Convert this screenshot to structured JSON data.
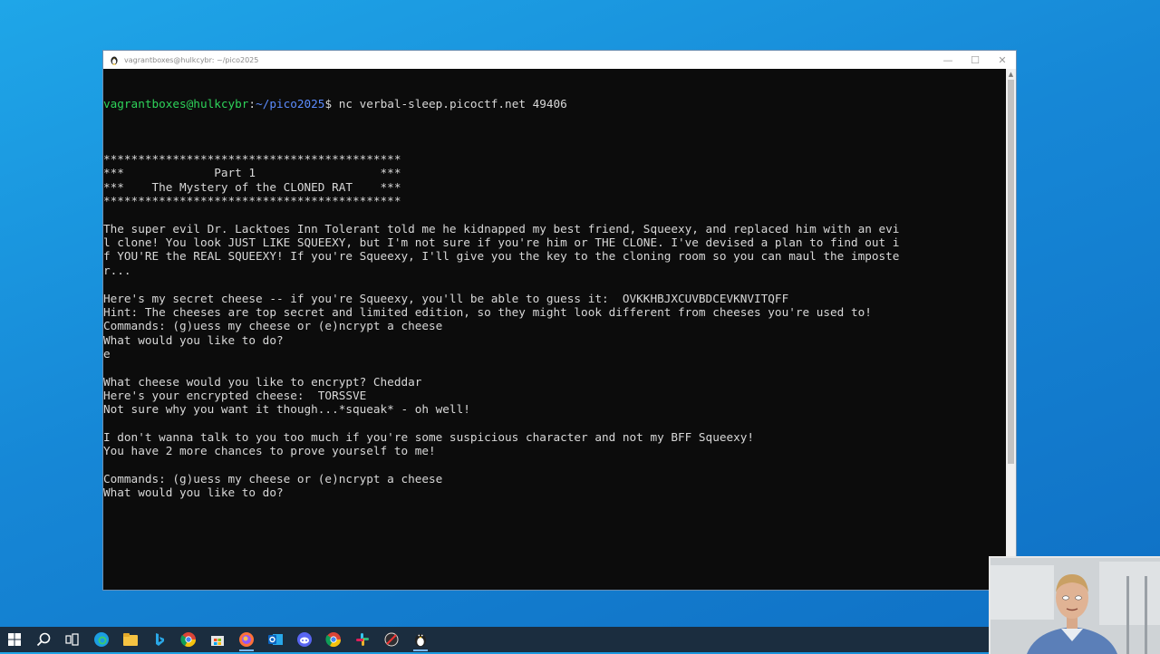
{
  "window": {
    "title": "vagrantboxes@hulkcybr: ~/pico2025",
    "controls": {
      "minimize": "—",
      "maximize": "☐",
      "close": "✕"
    }
  },
  "terminal": {
    "prompt_user": "vagrantboxes@hulkcybr",
    "prompt_sep": ":",
    "prompt_path": "~/pico2025",
    "prompt_end": "$ ",
    "command": "nc verbal-sleep.picoctf.net 49406",
    "lines": [
      "",
      "*******************************************",
      "***             Part 1                  ***",
      "***    The Mystery of the CLONED RAT    ***",
      "*******************************************",
      "",
      "The super evil Dr. Lacktoes Inn Tolerant told me he kidnapped my best friend, Squeexy, and replaced him with an evi",
      "l clone! You look JUST LIKE SQUEEXY, but I'm not sure if you're him or THE CLONE. I've devised a plan to find out i",
      "f YOU'RE the REAL SQUEEXY! If you're Squeexy, I'll give you the key to the cloning room so you can maul the imposte",
      "r...",
      "",
      "Here's my secret cheese -- if you're Squeexy, you'll be able to guess it:  OVKKHBJXCUVBDCEVKNVITQFF",
      "Hint: The cheeses are top secret and limited edition, so they might look different from cheeses you're used to!",
      "Commands: (g)uess my cheese or (e)ncrypt a cheese",
      "What would you like to do?",
      "e",
      "",
      "What cheese would you like to encrypt? Cheddar",
      "Here's your encrypted cheese:  TORSSVE",
      "Not sure why you want it though...*squeak* - oh well!",
      "",
      "I don't wanna talk to you too much if you're some suspicious character and not my BFF Squeexy!",
      "You have 2 more chances to prove yourself to me!",
      "",
      "Commands: (g)uess my cheese or (e)ncrypt a cheese",
      "What would you like to do?"
    ]
  },
  "taskbar": {
    "items": [
      {
        "name": "start-icon"
      },
      {
        "name": "search-icon"
      },
      {
        "name": "task-view-icon"
      },
      {
        "name": "edge-icon"
      },
      {
        "name": "file-explorer-icon"
      },
      {
        "name": "bing-icon"
      },
      {
        "name": "chrome-icon"
      },
      {
        "name": "store-icon"
      },
      {
        "name": "firefox-icon"
      },
      {
        "name": "outlook-icon"
      },
      {
        "name": "discord-icon"
      },
      {
        "name": "chrome-alt-icon"
      },
      {
        "name": "slack-icon"
      },
      {
        "name": "obs-icon"
      },
      {
        "name": "linux-terminal-icon"
      }
    ]
  },
  "colors": {
    "desktop": "#1687d6",
    "terminal_bg": "#0c0c0c",
    "terminal_text": "#d8d8d8",
    "prompt_user": "#2ed35a",
    "prompt_path": "#5c8cff",
    "taskbar": "#1b2d3f"
  }
}
